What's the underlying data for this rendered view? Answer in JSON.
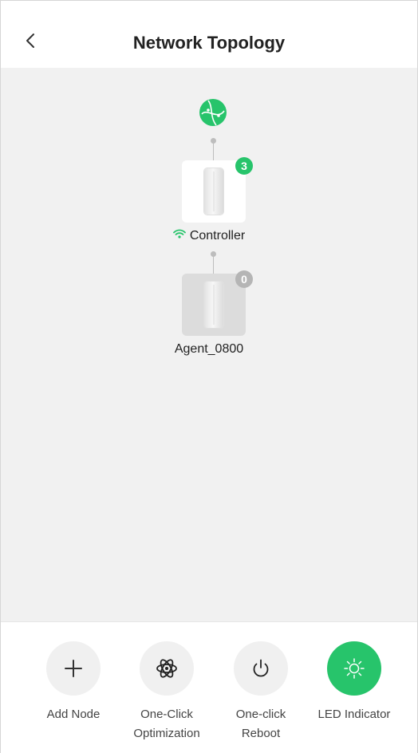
{
  "header": {
    "title": "Network Topology",
    "back_icon": "chevron-left-icon"
  },
  "topology": {
    "internet_icon": "globe-icon",
    "controller": {
      "name": "Controller",
      "connected_clients": "3",
      "signal_icon": "wifi-icon"
    },
    "agent": {
      "name": "Agent_0800",
      "connected_clients": "0"
    }
  },
  "actions": [
    {
      "label_line1": "Add Node",
      "label_line2": "",
      "icon": "plus-icon",
      "active": false
    },
    {
      "label_line1": "One-Click",
      "label_line2": "Optimization",
      "icon": "atom-icon",
      "active": false
    },
    {
      "label_line1": "One-click",
      "label_line2": "Reboot",
      "icon": "power-icon",
      "active": false
    },
    {
      "label_line1": "LED Indicator",
      "label_line2": "",
      "icon": "sun-icon",
      "active": true
    }
  ],
  "colors": {
    "accent": "#27c46b",
    "canvas_bg": "#f1f1f1",
    "inactive_badge": "#b5b5b5"
  }
}
